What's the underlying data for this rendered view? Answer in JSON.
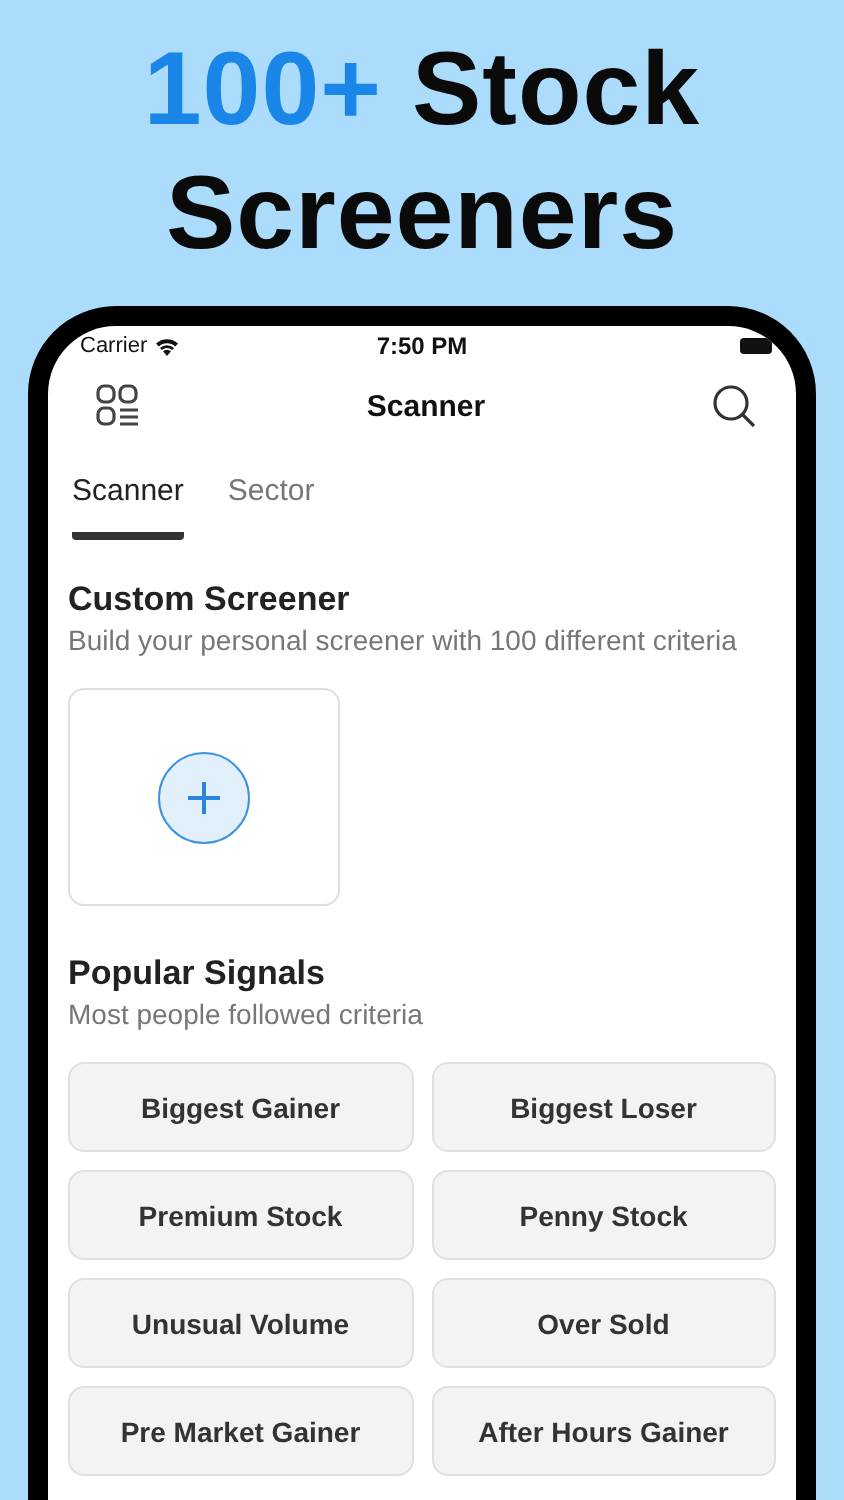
{
  "headline": {
    "highlight": "100+",
    "text": "Stock Screeners"
  },
  "status_bar": {
    "carrier": "Carrier",
    "time": "7:50 PM"
  },
  "nav": {
    "title": "Scanner"
  },
  "tabs": [
    {
      "label": "Scanner",
      "selected": true
    },
    {
      "label": "Sector",
      "selected": false
    }
  ],
  "custom_screener": {
    "title": "Custom Screener",
    "subtitle": "Build your personal screener with 100 different criteria"
  },
  "popular_signals": {
    "title": "Popular Signals",
    "subtitle": "Most people followed criteria",
    "items": [
      "Biggest Gainer",
      "Biggest Loser",
      "Premium Stock",
      "Penny Stock",
      "Unusual Volume",
      "Over Sold",
      "Pre Market Gainer",
      "After Hours Gainer"
    ]
  }
}
